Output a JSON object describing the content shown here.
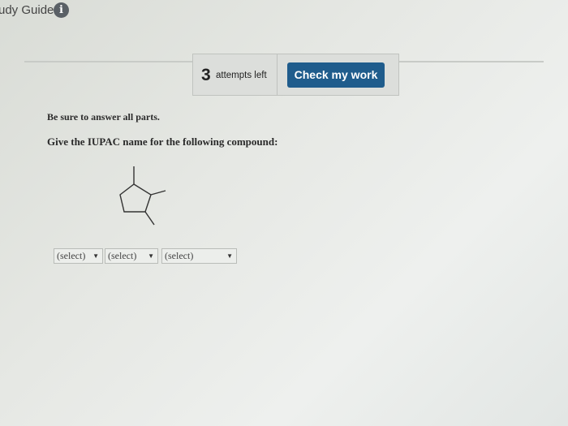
{
  "header": {
    "study_guide_label": "udy Guide",
    "info_icon_glyph": "i"
  },
  "attempts": {
    "count": "3",
    "label": "attempts left"
  },
  "actions": {
    "check_label": "Check my work"
  },
  "question": {
    "instruction": "Be sure to answer all parts.",
    "prompt": "Give the IUPAC name for the following compound:"
  },
  "answer_selects": [
    {
      "value": "(select)"
    },
    {
      "value": "(select)"
    },
    {
      "value": "(select)"
    }
  ],
  "colors": {
    "accent": "#1f5c8c"
  }
}
